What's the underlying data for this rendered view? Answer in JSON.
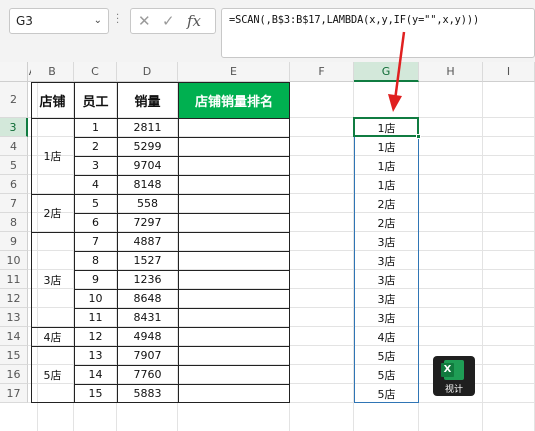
{
  "formula_bar": {
    "name_box": "G3",
    "name_box_dropdown": "⌄",
    "cancel_glyph": "✕",
    "enter_glyph": "✓",
    "fx_glyph": "fx",
    "formula": "=SCAN(,B$3:B$17,LAMBDA(x,y,IF(y=\"\",x,y)))"
  },
  "columns": [
    "A",
    "B",
    "C",
    "D",
    "E",
    "F",
    "G",
    "H",
    "I"
  ],
  "rows": [
    "2",
    "3",
    "4",
    "5",
    "6",
    "7",
    "8",
    "9",
    "10",
    "11",
    "12",
    "13",
    "14",
    "15",
    "16",
    "17"
  ],
  "selected_column": "G",
  "selected_row": "3",
  "table": {
    "headers": [
      "店铺",
      "员工",
      "销量",
      "店铺销量排名"
    ],
    "stores": [
      "1店",
      "2店",
      "3店",
      "4店",
      "5店"
    ],
    "employees": [
      "1",
      "2",
      "3",
      "4",
      "5",
      "6",
      "7",
      "8",
      "9",
      "10",
      "11",
      "12",
      "13",
      "14",
      "15"
    ],
    "sales": [
      "2811",
      "5299",
      "9704",
      "8148",
      "558",
      "7297",
      "4887",
      "1527",
      "1236",
      "8648",
      "8431",
      "4948",
      "7907",
      "7760",
      "5883"
    ]
  },
  "scan_result": [
    "1店",
    "1店",
    "1店",
    "1店",
    "2店",
    "2店",
    "3店",
    "3店",
    "3店",
    "3店",
    "3店",
    "4店",
    "5店",
    "5店",
    "5店"
  ],
  "colors": {
    "header_green": "#00b050",
    "selection_green": "#107c41",
    "arrow_red": "#e02020",
    "range_blue": "#2f75b5"
  },
  "watermark": {
    "icon_letter": "X",
    "label": "视计"
  }
}
